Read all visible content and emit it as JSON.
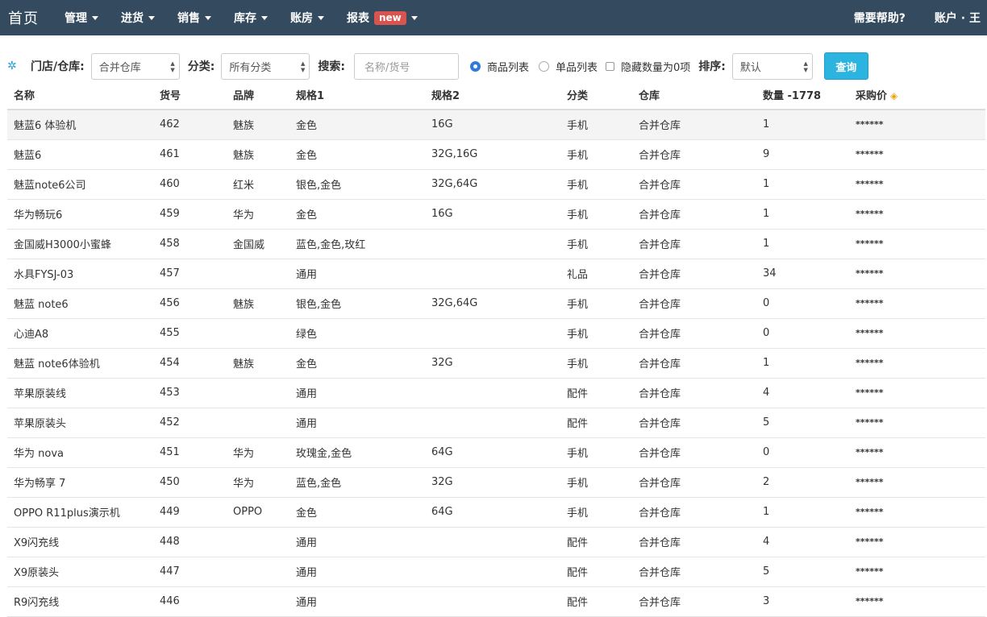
{
  "nav": {
    "brand": "首页",
    "items": [
      {
        "label": "管理"
      },
      {
        "label": "进货"
      },
      {
        "label": "销售"
      },
      {
        "label": "库存"
      },
      {
        "label": "账房"
      },
      {
        "label": "报表",
        "badge": "new"
      }
    ],
    "help": "需要帮助?",
    "account": "账户 · 王"
  },
  "toolbar": {
    "store_label": "门店/仓库:",
    "store_value": "合并仓库",
    "category_label": "分类:",
    "category_value": "所有分类",
    "search_label": "搜索:",
    "search_placeholder": "名称/货号",
    "radio_product_list": "商品列表",
    "radio_item_list": "单品列表",
    "checkbox_hide_zero": "隐藏数量为0项",
    "sort_label": "排序:",
    "sort_value": "默认",
    "query_button": "查询"
  },
  "table": {
    "headers": [
      "名称",
      "货号",
      "品牌",
      "规格1",
      "规格2",
      "分类",
      "仓库",
      "数量 -1778",
      "采购价"
    ],
    "rows": [
      [
        "魅蓝6 体验机",
        "462",
        "魅族",
        "金色",
        "16G",
        "手机",
        "合并仓库",
        "1",
        "******"
      ],
      [
        "魅蓝6",
        "461",
        "魅族",
        "金色",
        "32G,16G",
        "手机",
        "合并仓库",
        "9",
        "******"
      ],
      [
        "魅蓝note6公司",
        "460",
        "红米",
        "银色,金色",
        "32G,64G",
        "手机",
        "合并仓库",
        "1",
        "******"
      ],
      [
        "华为畅玩6",
        "459",
        "华为",
        "金色",
        "16G",
        "手机",
        "合并仓库",
        "1",
        "******"
      ],
      [
        "金国威H3000小蜜蜂",
        "458",
        "金国威",
        "蓝色,金色,玫红",
        "",
        "手机",
        "合并仓库",
        "1",
        "******"
      ],
      [
        "水具FYSJ-03",
        "457",
        "",
        "通用",
        "",
        "礼品",
        "合并仓库",
        "34",
        "******"
      ],
      [
        "魅蓝 note6",
        "456",
        "魅族",
        "银色,金色",
        "32G,64G",
        "手机",
        "合并仓库",
        "0",
        "******"
      ],
      [
        "心迪A8",
        "455",
        "",
        "绿色",
        "",
        "手机",
        "合并仓库",
        "0",
        "******"
      ],
      [
        "魅蓝 note6体验机",
        "454",
        "魅族",
        "金色",
        "32G",
        "手机",
        "合并仓库",
        "1",
        "******"
      ],
      [
        "苹果原装线",
        "453",
        "",
        "通用",
        "",
        "配件",
        "合并仓库",
        "4",
        "******"
      ],
      [
        "苹果原装头",
        "452",
        "",
        "通用",
        "",
        "配件",
        "合并仓库",
        "5",
        "******"
      ],
      [
        "华为 nova",
        "451",
        "华为",
        "玫瑰金,金色",
        "64G",
        "手机",
        "合并仓库",
        "0",
        "******"
      ],
      [
        "华为畅享 7",
        "450",
        "华为",
        "蓝色,金色",
        "32G",
        "手机",
        "合并仓库",
        "2",
        "******"
      ],
      [
        "OPPO R11plus演示机",
        "449",
        "OPPO",
        "金色",
        "64G",
        "手机",
        "合并仓库",
        "1",
        "******"
      ],
      [
        "X9闪充线",
        "448",
        "",
        "通用",
        "",
        "配件",
        "合并仓库",
        "4",
        "******"
      ],
      [
        "X9原装头",
        "447",
        "",
        "通用",
        "",
        "配件",
        "合并仓库",
        "5",
        "******"
      ],
      [
        "R9闪充线",
        "446",
        "",
        "通用",
        "",
        "配件",
        "合并仓库",
        "3",
        "******"
      ]
    ]
  }
}
